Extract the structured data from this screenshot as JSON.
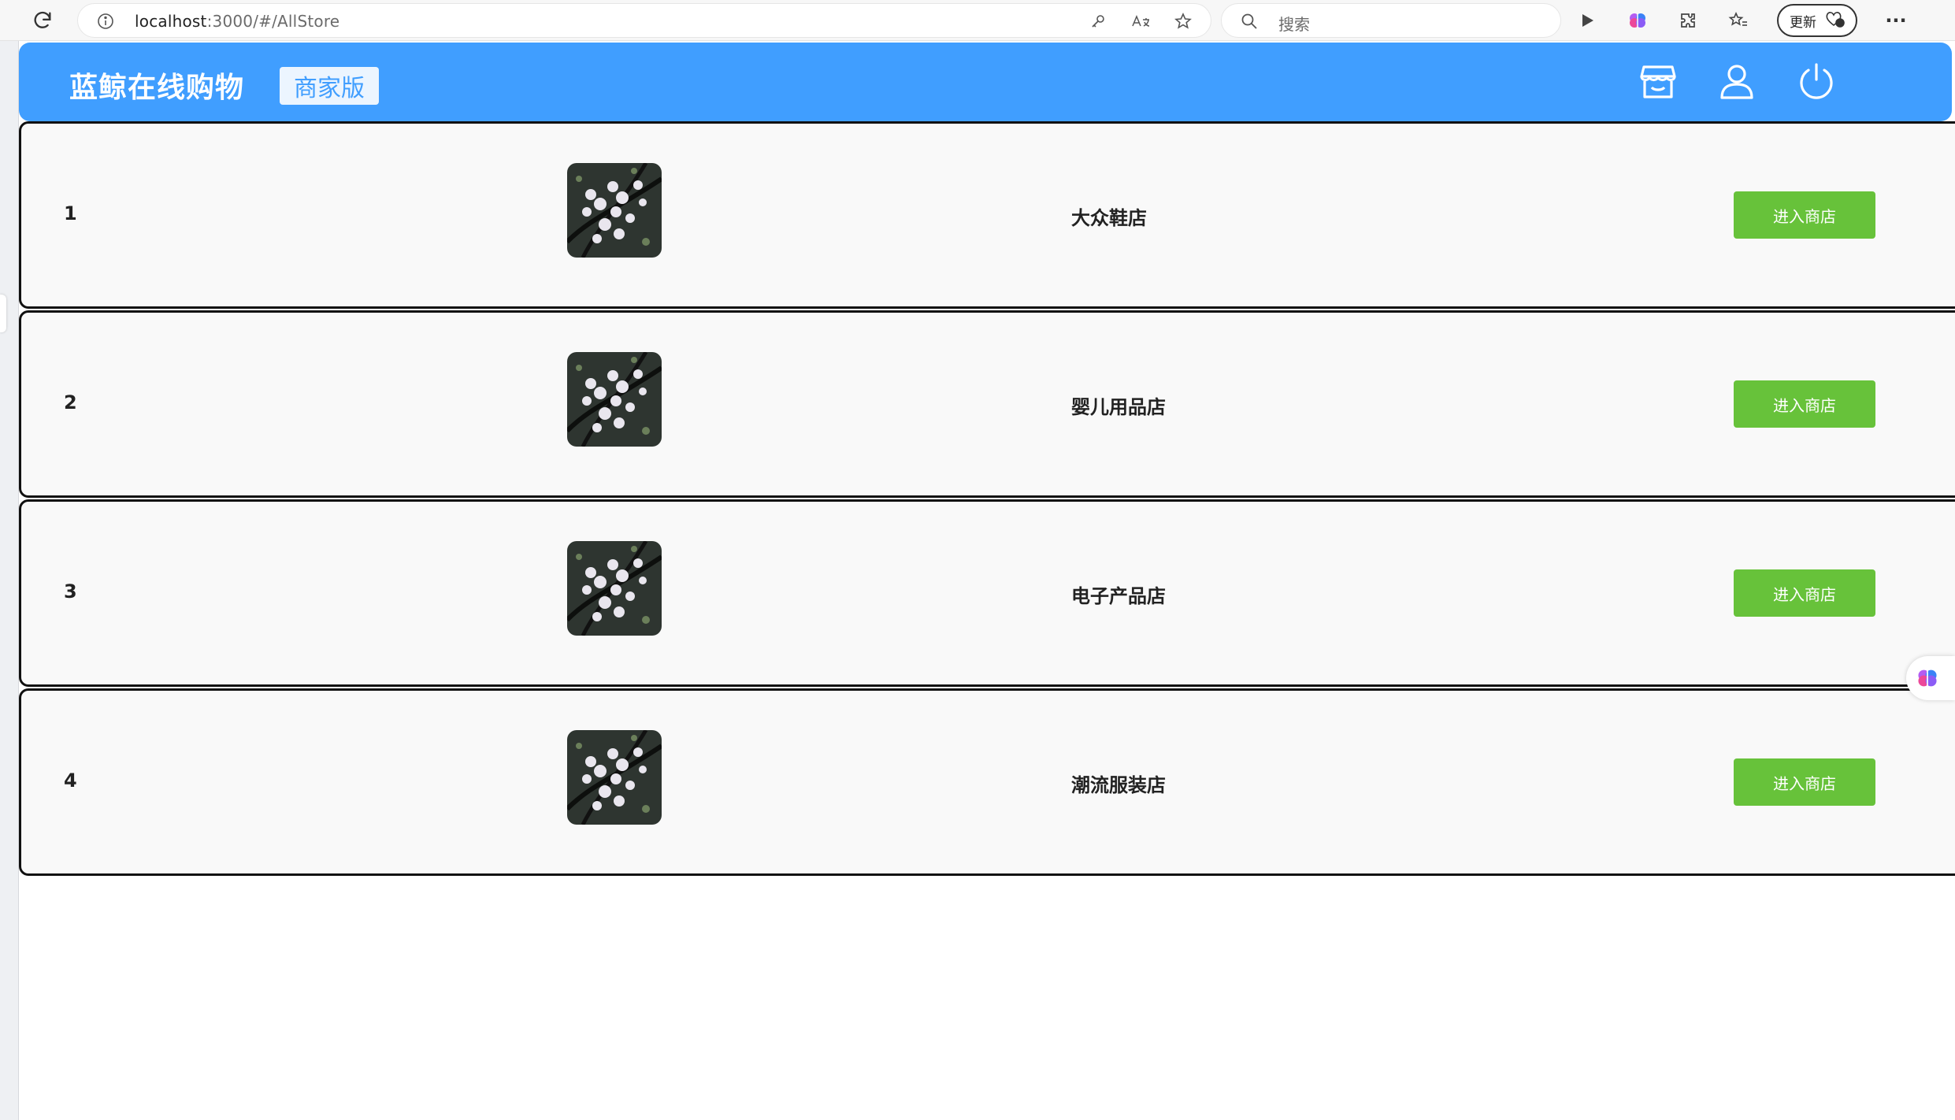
{
  "browser": {
    "url_host": "localhost",
    "url_path": ":3000/#/AllStore",
    "search_placeholder": "搜索",
    "update_label": "更新"
  },
  "header": {
    "brand": "蓝鲸在线购物",
    "edition": "商家版",
    "icons": [
      "store-icon",
      "user-icon",
      "power-icon"
    ]
  },
  "colors": {
    "header_bg": "#409eff",
    "tag_bg": "#ecf5ff",
    "button_bg": "#67c23a",
    "row_bg": "#f9f9f9"
  },
  "stores": [
    {
      "index": "1",
      "name": "大众鞋店",
      "button": "进入商店"
    },
    {
      "index": "2",
      "name": "婴儿用品店",
      "button": "进入商店"
    },
    {
      "index": "3",
      "name": "电子产品店",
      "button": "进入商店"
    },
    {
      "index": "4",
      "name": "潮流服装店",
      "button": "进入商店"
    }
  ]
}
